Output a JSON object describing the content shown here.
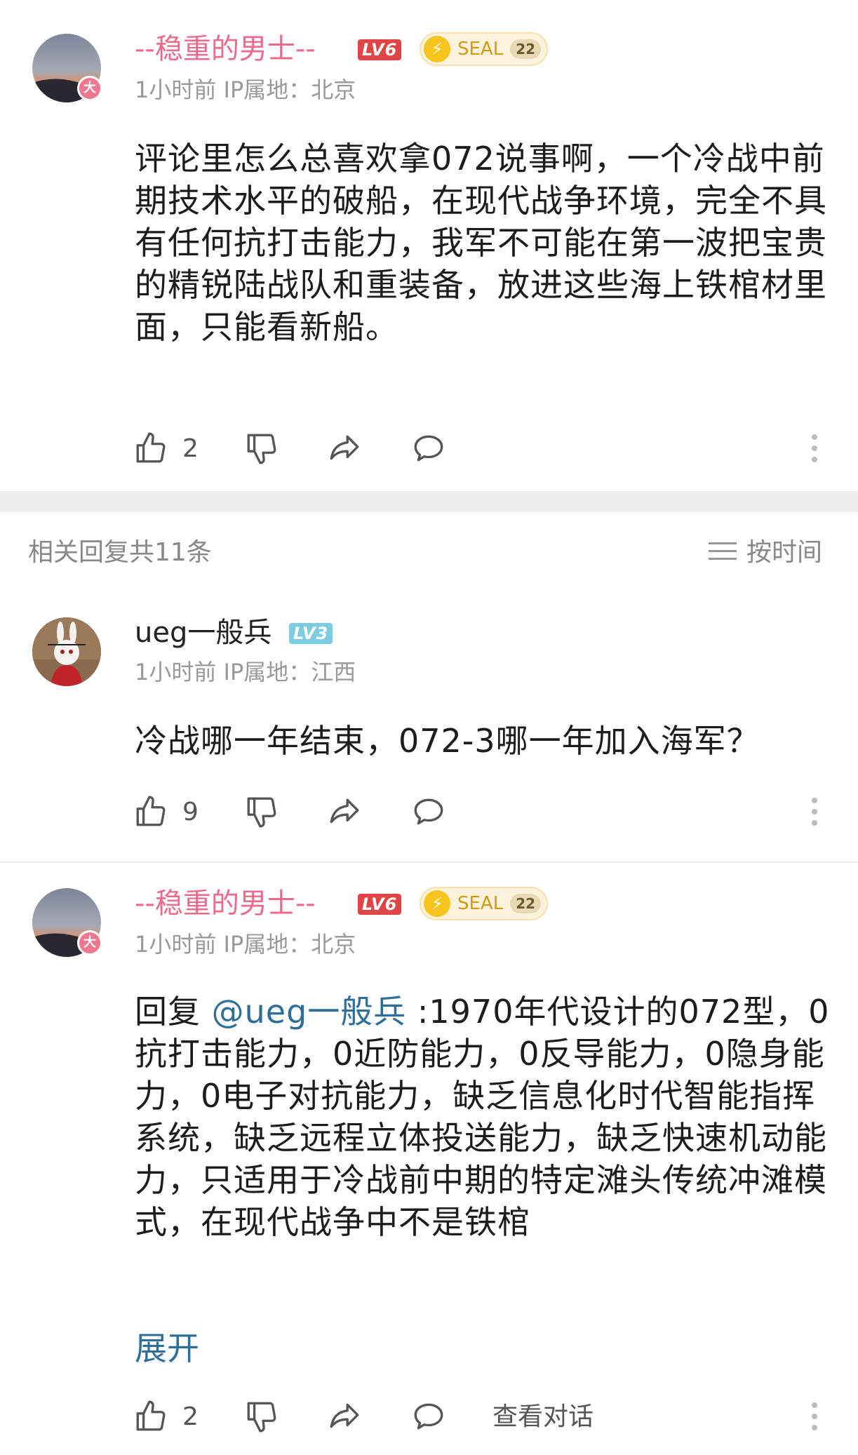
{
  "comments": [
    {
      "name": "--稳重的男士--",
      "level": "LV6",
      "seal_label": "SEAL",
      "seal_num": "22",
      "vip": "大",
      "meta": "1小时前 IP属地：北京",
      "text": "评论里怎么总喜欢拿072说事啊，一个冷战中前期技术水平的破船，在现代战争环境，完全不具有任何抗打击能力，我军不可能在第一波把宝贵的精锐陆战队和重装备，放进这些海上铁棺材里面，只能看新船。",
      "likes": "2"
    },
    {
      "name": "ueg一般兵",
      "level": "LV3",
      "meta": "1小时前 IP属地：江西",
      "text": "冷战哪一年结束，072-3哪一年加入海军？",
      "likes": "9"
    },
    {
      "name": "--稳重的男士--",
      "level": "LV6",
      "seal_label": "SEAL",
      "seal_num": "22",
      "vip": "大",
      "meta": "1小时前 IP属地：北京",
      "reply_prefix": "回复 ",
      "mention": "@ueg一般兵",
      "text": " :1970年代设计的072型，0抗打击能力，0近防能力，0反导能力，0隐身能力，0电子对抗能力，缺乏信息化时代智能指挥系统，缺乏远程立体投送能力，缺乏快速机动能力，只适用于冷战前中期的特定滩头传统冲滩模式，在现代战争中不是铁棺",
      "expand": "展开",
      "likes": "2",
      "view_dialog": "查看对话"
    }
  ],
  "replies_header": {
    "count_label": "相关回复共11条",
    "sort_label": "按时间"
  },
  "icons": {
    "like": "thumbs-up-icon",
    "dislike": "thumbs-down-icon",
    "share": "share-icon",
    "comment": "comment-bubble-icon",
    "more": "more-vertical-icon",
    "sort": "sort-lines-icon"
  },
  "colors": {
    "name_pink": "#ec6b8c",
    "mention_blue": "#2d6f9a",
    "level_red": "#e04545",
    "level_blue": "#7ccde0",
    "seal_gold": "#f7c31d"
  }
}
